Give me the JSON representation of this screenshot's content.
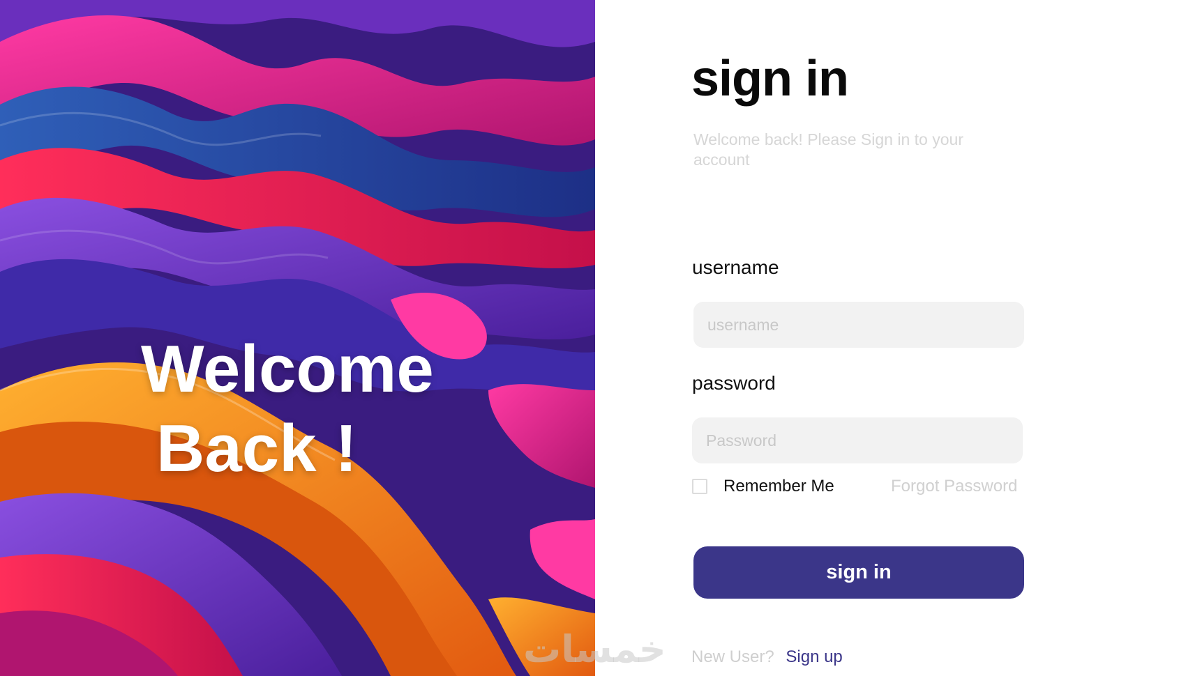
{
  "hero": {
    "line1": "Welcome",
    "line2": "Back !"
  },
  "watermark": "خمسات",
  "form": {
    "title": "sign in",
    "subtitle": "Welcome back! Please Sign in to your account",
    "username_label": "username",
    "username_placeholder": "username",
    "username_value": "",
    "password_label": "password",
    "password_placeholder": "Password",
    "password_value": "",
    "remember_label": "Remember Me",
    "remember_checked": false,
    "forgot_label": "Forgot Password",
    "submit_label": "sign in",
    "new_user_text": "New User?",
    "signup_label": "Sign up"
  },
  "colors": {
    "primary": "#3b3689",
    "input_bg": "#f2f2f2",
    "muted_text": "#d0d0d0"
  }
}
